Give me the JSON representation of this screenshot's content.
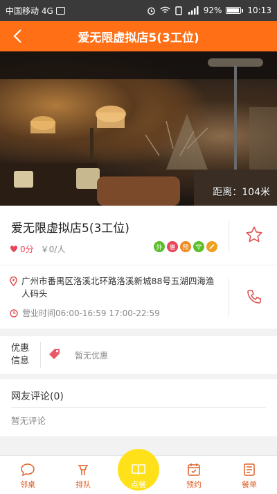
{
  "status_bar": {
    "carrier": "中国移动 4G",
    "battery": "92%",
    "time": "10:13"
  },
  "header": {
    "title": "爱无限虚拟店5(3工位)",
    "back_icon": "back-arrow-icon"
  },
  "hero": {
    "distance": "距离：104米"
  },
  "shop": {
    "name": "爱无限虚拟店5(3工位)",
    "score": "0分",
    "avg_price": "￥0/人",
    "services": [
      {
        "label": "外",
        "color": "#5cbf2a"
      },
      {
        "label": "惠",
        "color": "#e8465a"
      },
      {
        "label": "预",
        "color": "#f08c24"
      },
      {
        "label": "wifi",
        "color": "#5cbf2a"
      },
      {
        "label": "停",
        "color": "#f0a020"
      }
    ]
  },
  "address": {
    "text": "广州市番禺区洛溪北环路洛溪新城88号五湖四海渔人码头",
    "hours": "营业时间06:00-16:59 17:00-22:59"
  },
  "promo": {
    "label": "优惠信息",
    "text": "暂无优惠"
  },
  "reviews": {
    "title": "网友评论(0)",
    "empty": "暂无评论"
  },
  "bottom_nav": [
    {
      "label": "邻桌",
      "icon": "chat-bubble-icon"
    },
    {
      "label": "排队",
      "icon": "queue-icon"
    },
    {
      "label": "点餐",
      "icon": "menu-book-icon"
    },
    {
      "label": "预约",
      "icon": "calendar-icon"
    },
    {
      "label": "餐单",
      "icon": "bill-icon"
    }
  ],
  "colors": {
    "primary": "#ff6f15",
    "active_nav": "#ffe11a",
    "icon_red": "#e05050"
  }
}
